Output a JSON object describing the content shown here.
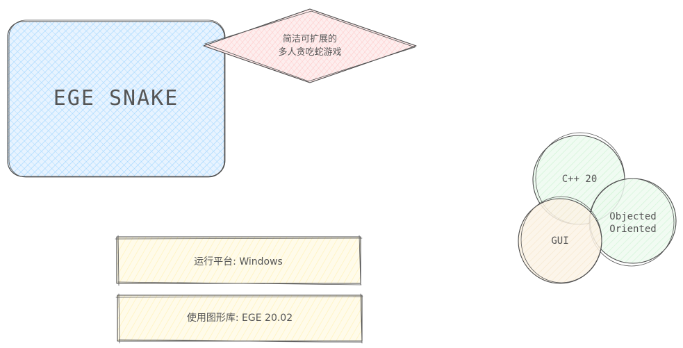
{
  "title_box": {
    "text": "EGE SNAKE",
    "fill_color": "#a5d8ff"
  },
  "diamond": {
    "line1": "简洁可扩展的",
    "line2": "多人贪吃蛇游戏",
    "fill_color": "#ffc9c9"
  },
  "info_boxes": [
    {
      "text": "运行平台: Windows",
      "fill_color": "#fff3bf"
    },
    {
      "text": "使用图形库: EGE 20.02",
      "fill_color": "#fff3bf"
    }
  ],
  "venn": {
    "cpp": {
      "text": "C++ 20",
      "fill_color": "#b2f2bb"
    },
    "oop": {
      "line1": "Objected",
      "line2": "Oriented",
      "fill_color": "#b2f2bb"
    },
    "gui": {
      "text": "GUI",
      "fill_color": "#ffec99"
    }
  }
}
